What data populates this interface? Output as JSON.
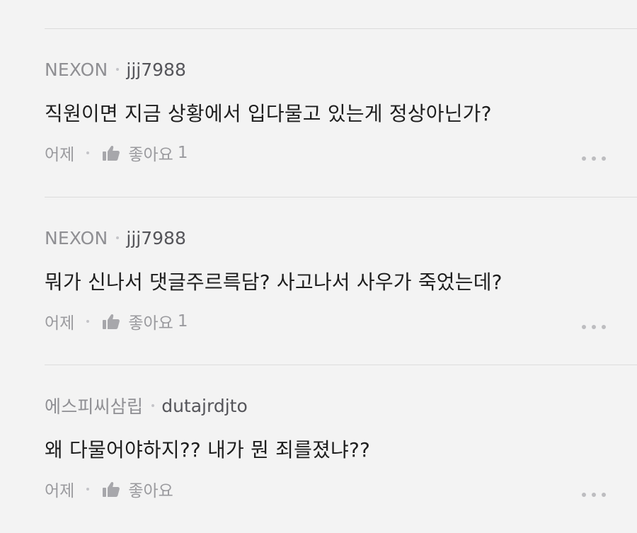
{
  "comments": [
    {
      "org": "NEXON",
      "user": "jjj7988",
      "text": "직원이면 지금 상황에서 입다물고 있는게 정상아닌가?",
      "time": "어제",
      "like_label": "좋아요",
      "like_count": "1"
    },
    {
      "org": "NEXON",
      "user": "jjj7988",
      "text": "뭐가 신나서 댓글주르륵담? 사고나서 사우가 죽었는데?",
      "time": "어제",
      "like_label": "좋아요",
      "like_count": "1"
    },
    {
      "org": "에스피씨삼립",
      "user": "dutajrdjto",
      "text": "왜 다물어야하지?? 내가 뭔 죄를졌냐??",
      "time": "어제",
      "like_label": "좋아요",
      "like_count": ""
    }
  ],
  "icons": {
    "like": "thumbs-up-icon",
    "more": "more-horizontal-icon",
    "separator": "dot-separator-icon"
  },
  "colors": {
    "background": "#f3f3f3",
    "divider": "#dcdcdc",
    "org": "#8f8f93",
    "user": "#55555a",
    "body": "#1e1e1e",
    "meta": "#9a9a9e"
  }
}
